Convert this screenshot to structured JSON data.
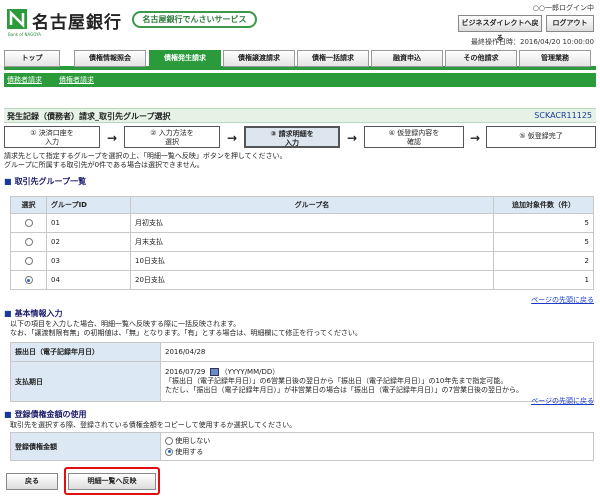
{
  "header": {
    "bank_name": "名古屋銀行",
    "bank_sub": "Bank of NAGOYA",
    "service_name": "名古屋銀行でんさいサービス",
    "user_name": "○○一郎ログイン中",
    "direct_button": "ビジネスダイレクトへ戻る",
    "logout_button": "ログアウト",
    "last_operation": "最終操作日時：2016/04/20 10:00:00"
  },
  "tabs": [
    {
      "label": "トップ"
    },
    {
      "label": "債権情報照会"
    },
    {
      "label": "債権発生請求"
    },
    {
      "label": "債権譲渡請求"
    },
    {
      "label": "債権一括請求"
    },
    {
      "label": "融資申込"
    },
    {
      "label": "その他請求"
    },
    {
      "label": "管理業務"
    }
  ],
  "subnav": [
    "債務者請求",
    "債権者請求"
  ],
  "page": {
    "title": "発生記録（債務者）請求_取引先グループ選択",
    "screen_id": "SCKACR11125"
  },
  "steps": [
    {
      "line1": "① 決済口座を",
      "line2": "入力"
    },
    {
      "line1": "② 入力方法を",
      "line2": "選択"
    },
    {
      "line1": "③ 請求明細を",
      "line2": "入力"
    },
    {
      "line1": "④ 仮登録内容を",
      "line2": "確認"
    },
    {
      "line1": "⑤ 仮登録完了",
      "line2": ""
    }
  ],
  "intro": {
    "line1": "請求先として指定するグループを選択の上、「明細一覧へ反映」ボタンを押してください。",
    "line2": "グループに所属する取引先が0件である場合は選択できません。"
  },
  "group_section": {
    "title": "取引先グループ一覧",
    "headers": {
      "select": "選択",
      "id": "グループID",
      "name": "グループ名",
      "count": "追加対象件数（件）"
    },
    "rows": [
      {
        "id": "01",
        "name": "月初支払",
        "count": "5",
        "selected": false
      },
      {
        "id": "02",
        "name": "月末支払",
        "count": "5",
        "selected": false
      },
      {
        "id": "03",
        "name": "10日支払",
        "count": "2",
        "selected": false
      },
      {
        "id": "04",
        "name": "20日支払",
        "count": "1",
        "selected": true
      }
    ]
  },
  "page_top_link": "ページの先頭に戻る",
  "basic_section": {
    "title": "基本情報入力",
    "line1": "以下の項目を入力した場合、明細一覧へ反映する際に一括反映されます。",
    "line2": "なお、「譲渡制限有無」の初期値は、「無」となります。「有」とする場合は、明細欄にて修正を行ってください。",
    "issue_label": "振出日（電子記録年月日）",
    "issue_value": "2016/04/28",
    "pay_label": "支払期日",
    "pay_value": "2016/07/29",
    "pay_format": "（YYYY/MM/DD）",
    "pay_note1": "「振出日（電子記録年月日）」の6営業日後の翌日から「振出日（電子記録年月日）」の10年先まで指定可能。",
    "pay_note2": "ただし、「振出日（電子記録年月日）」が非営業日の場合は「振出日（電子記録年月日）」の7営業日後の翌日から。"
  },
  "amount_section": {
    "title": "登録債権金額の使用",
    "desc": "取引先を選択する際、登録されている債権金額をコピーして使用するか選択してください。",
    "label": "登録債権金額",
    "option_no": "使用しない",
    "option_yes": "使用する",
    "selected": "使用する"
  },
  "buttons": {
    "back": "戻る",
    "reflect": "明細一覧へ反映"
  }
}
